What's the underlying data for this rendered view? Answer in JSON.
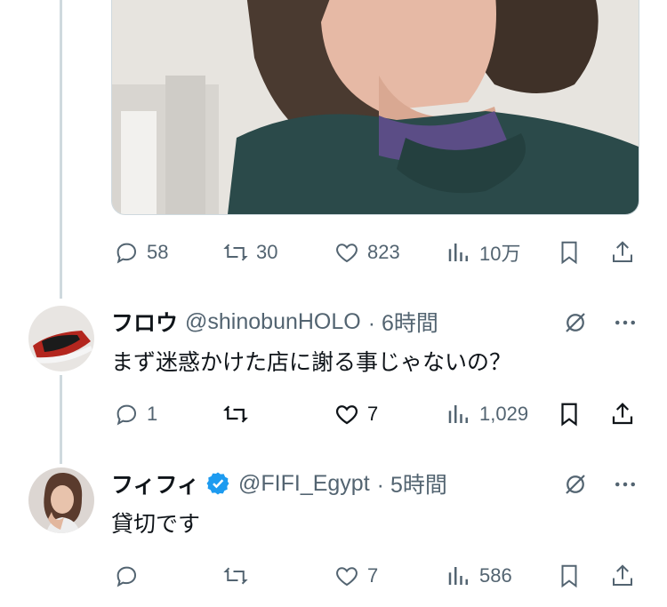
{
  "main_tweet": {
    "actions": {
      "replies": "58",
      "retweets": "30",
      "likes": "823",
      "views": "10万"
    }
  },
  "replies": [
    {
      "name": "フロウ",
      "handle": "@shinobunHOLO",
      "time": "· 6時間",
      "text": "まず迷惑かけた店に謝る事じゃないの？",
      "verified": false,
      "actions": {
        "replies": "1",
        "retweets": "",
        "likes": "7",
        "views": "1,029"
      }
    },
    {
      "name": "フィフィ",
      "handle": "@FIFI_Egypt",
      "time": "· 5時間",
      "text": "貸切です",
      "verified": true,
      "actions": {
        "replies": "",
        "retweets": "",
        "likes": "7",
        "views": "586"
      }
    }
  ],
  "colors": {
    "text": "#0f1419",
    "muted": "#536471",
    "border": "#cfd9de",
    "verified_blue": "#1d9bf0"
  }
}
